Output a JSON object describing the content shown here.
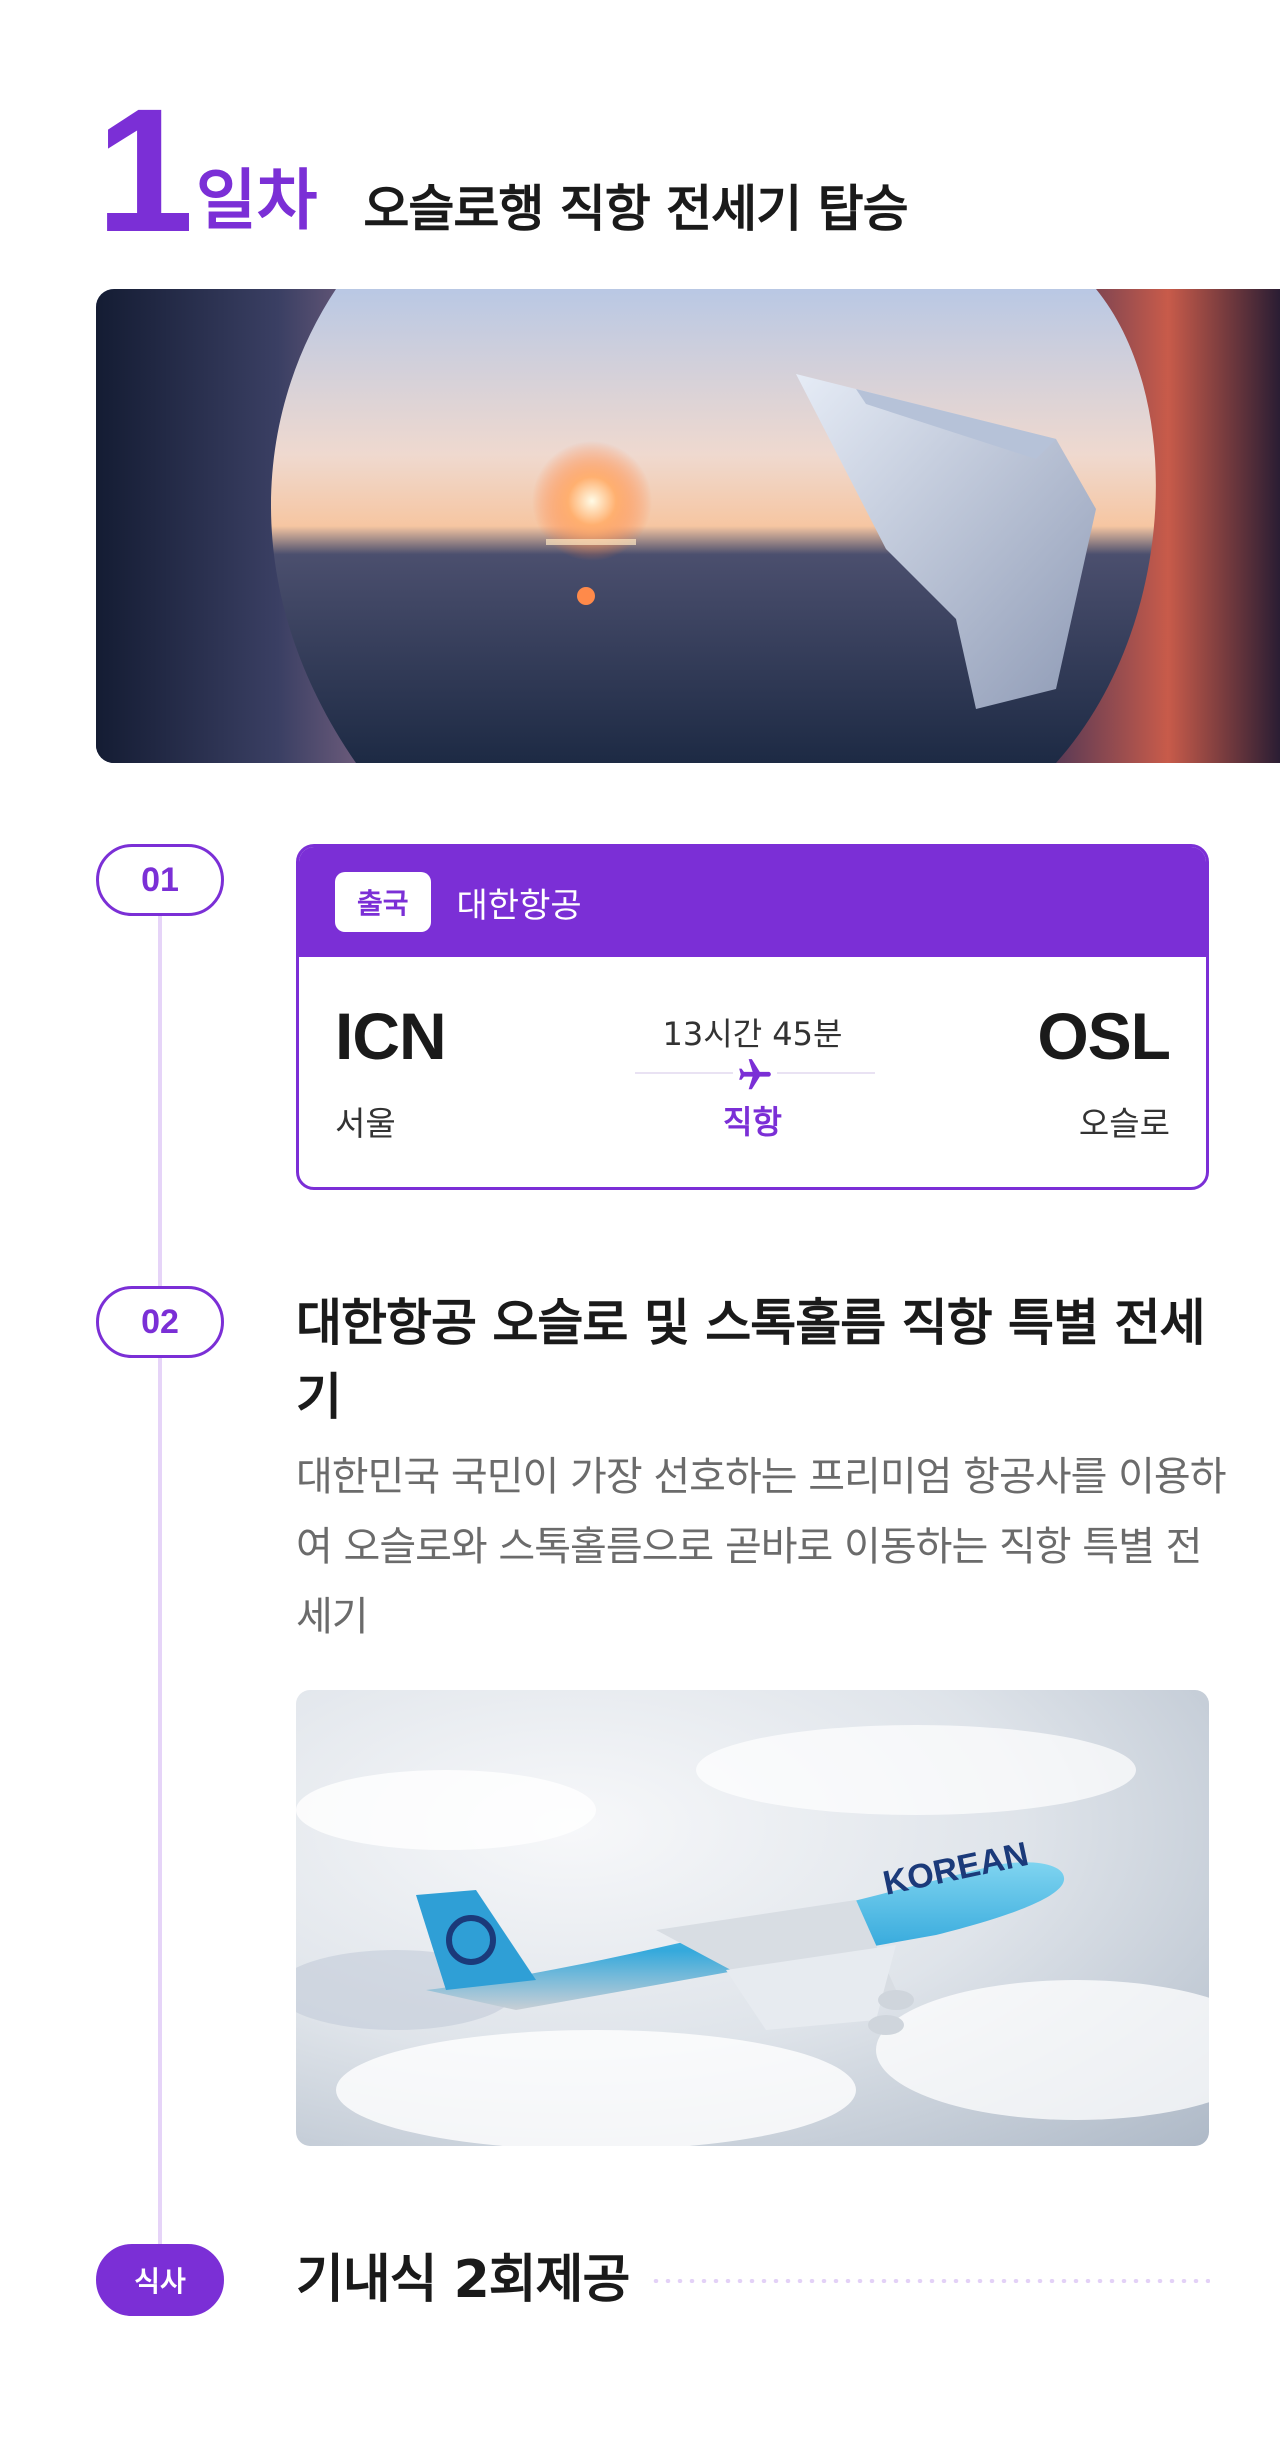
{
  "day": {
    "number": "1",
    "unit": "일차",
    "title": "오슬로행 직항 전세기 탑승"
  },
  "steps": [
    {
      "badge": "01",
      "flight": {
        "badge": "출국",
        "airline": "대한항공",
        "from_code": "ICN",
        "from_city": "서울",
        "to_code": "OSL",
        "to_city": "오슬로",
        "duration": "13시간 45분",
        "type": "직항"
      }
    },
    {
      "badge": "02",
      "title": "대한항공 오슬로 및 스톡홀름 직항 특별 전세기",
      "description": "대한민국 국민이 가장 선호하는 프리미엄 항공사를 이용하여 오슬로와 스톡홀름으로 곧바로 이동하는 직항 특별 전세기"
    }
  ],
  "meal": {
    "badge": "식사",
    "text": "기내식 2회제공"
  },
  "aircraft_livery": "KOREAN",
  "colors": {
    "accent": "#7b2fd6",
    "timeline": "#e6d4f8",
    "description_text": "#6b6b6b"
  },
  "icons": {
    "route": "airplane-icon"
  }
}
